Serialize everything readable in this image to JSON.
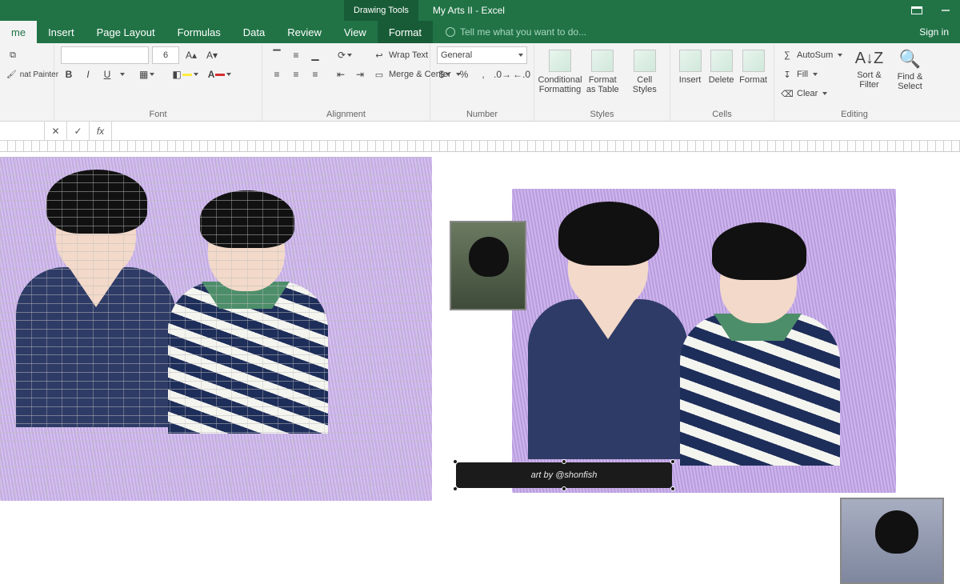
{
  "title": {
    "contextual_tab": "Drawing Tools",
    "document": "My Arts II - Excel"
  },
  "tabs": {
    "home": "me",
    "insert": "Insert",
    "pagelayout": "Page Layout",
    "formulas": "Formulas",
    "data": "Data",
    "review": "Review",
    "view": "View",
    "format": "Format"
  },
  "tellme": "Tell me what you want to do...",
  "signin": "Sign in",
  "ribbon": {
    "clipboard": {
      "paste": "",
      "painter": "nat Painter",
      "label": ""
    },
    "font": {
      "name": "",
      "size": "6",
      "bold": "B",
      "italic": "I",
      "underline": "U",
      "label": "Font"
    },
    "alignment": {
      "wrap": "Wrap Text",
      "merge": "Merge & Center",
      "label": "Alignment"
    },
    "number": {
      "format": "General",
      "label": "Number"
    },
    "styles": {
      "cond": "Conditional Formatting",
      "table": "Format as Table",
      "cell": "Cell Styles",
      "label": "Styles"
    },
    "cells": {
      "insert": "Insert",
      "delete": "Delete",
      "format": "Format",
      "label": "Cells"
    },
    "editing": {
      "autosum": "AutoSum",
      "fill": "Fill",
      "clear": "Clear",
      "sort": "Sort & Filter",
      "find": "Find & Select",
      "label": "Editing"
    }
  },
  "formula_bar": {
    "fx": "fx"
  },
  "signature": "art by @shonfish",
  "colors": {
    "excel_green": "#217346",
    "purple_bg": "#b99cde",
    "skin": "#f3d9c9",
    "navy": "#2e3b66",
    "green_collar": "#4d8e6a"
  }
}
